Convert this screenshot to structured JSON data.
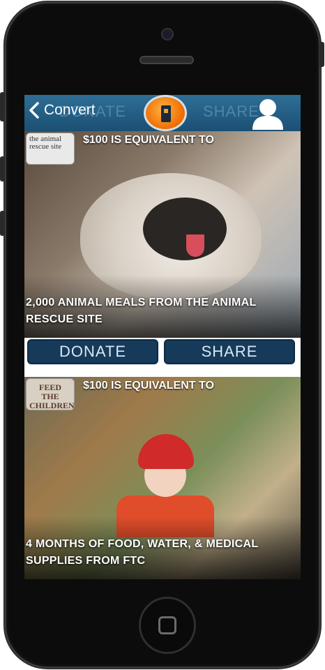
{
  "header": {
    "back_label": "Convert",
    "ghost_left": "DONATE",
    "ghost_right": "SHARE"
  },
  "cards": [
    {
      "badge": "the animal rescue site",
      "headline": "$100 IS EQUIVALENT TO",
      "caption": "2,000 ANIMAL MEALS FROM THE ANIMAL RESCUE SITE"
    },
    {
      "badge": "FEED THE CHILDREN",
      "headline": "$100 IS EQUIVALENT TO",
      "caption": "4 MONTHS OF FOOD, WATER, & MEDICAL SUPPLIES FROM FTC"
    }
  ],
  "actions": {
    "donate_label": "DONATE",
    "share_label": "SHARE"
  },
  "colors": {
    "topbar": "#1c4f73",
    "button": "#163a5a",
    "logo": "#ef6b00"
  },
  "icons": [
    "back-chevron-icon",
    "app-logo-icon",
    "profile-icon",
    "home-button-icon"
  ]
}
